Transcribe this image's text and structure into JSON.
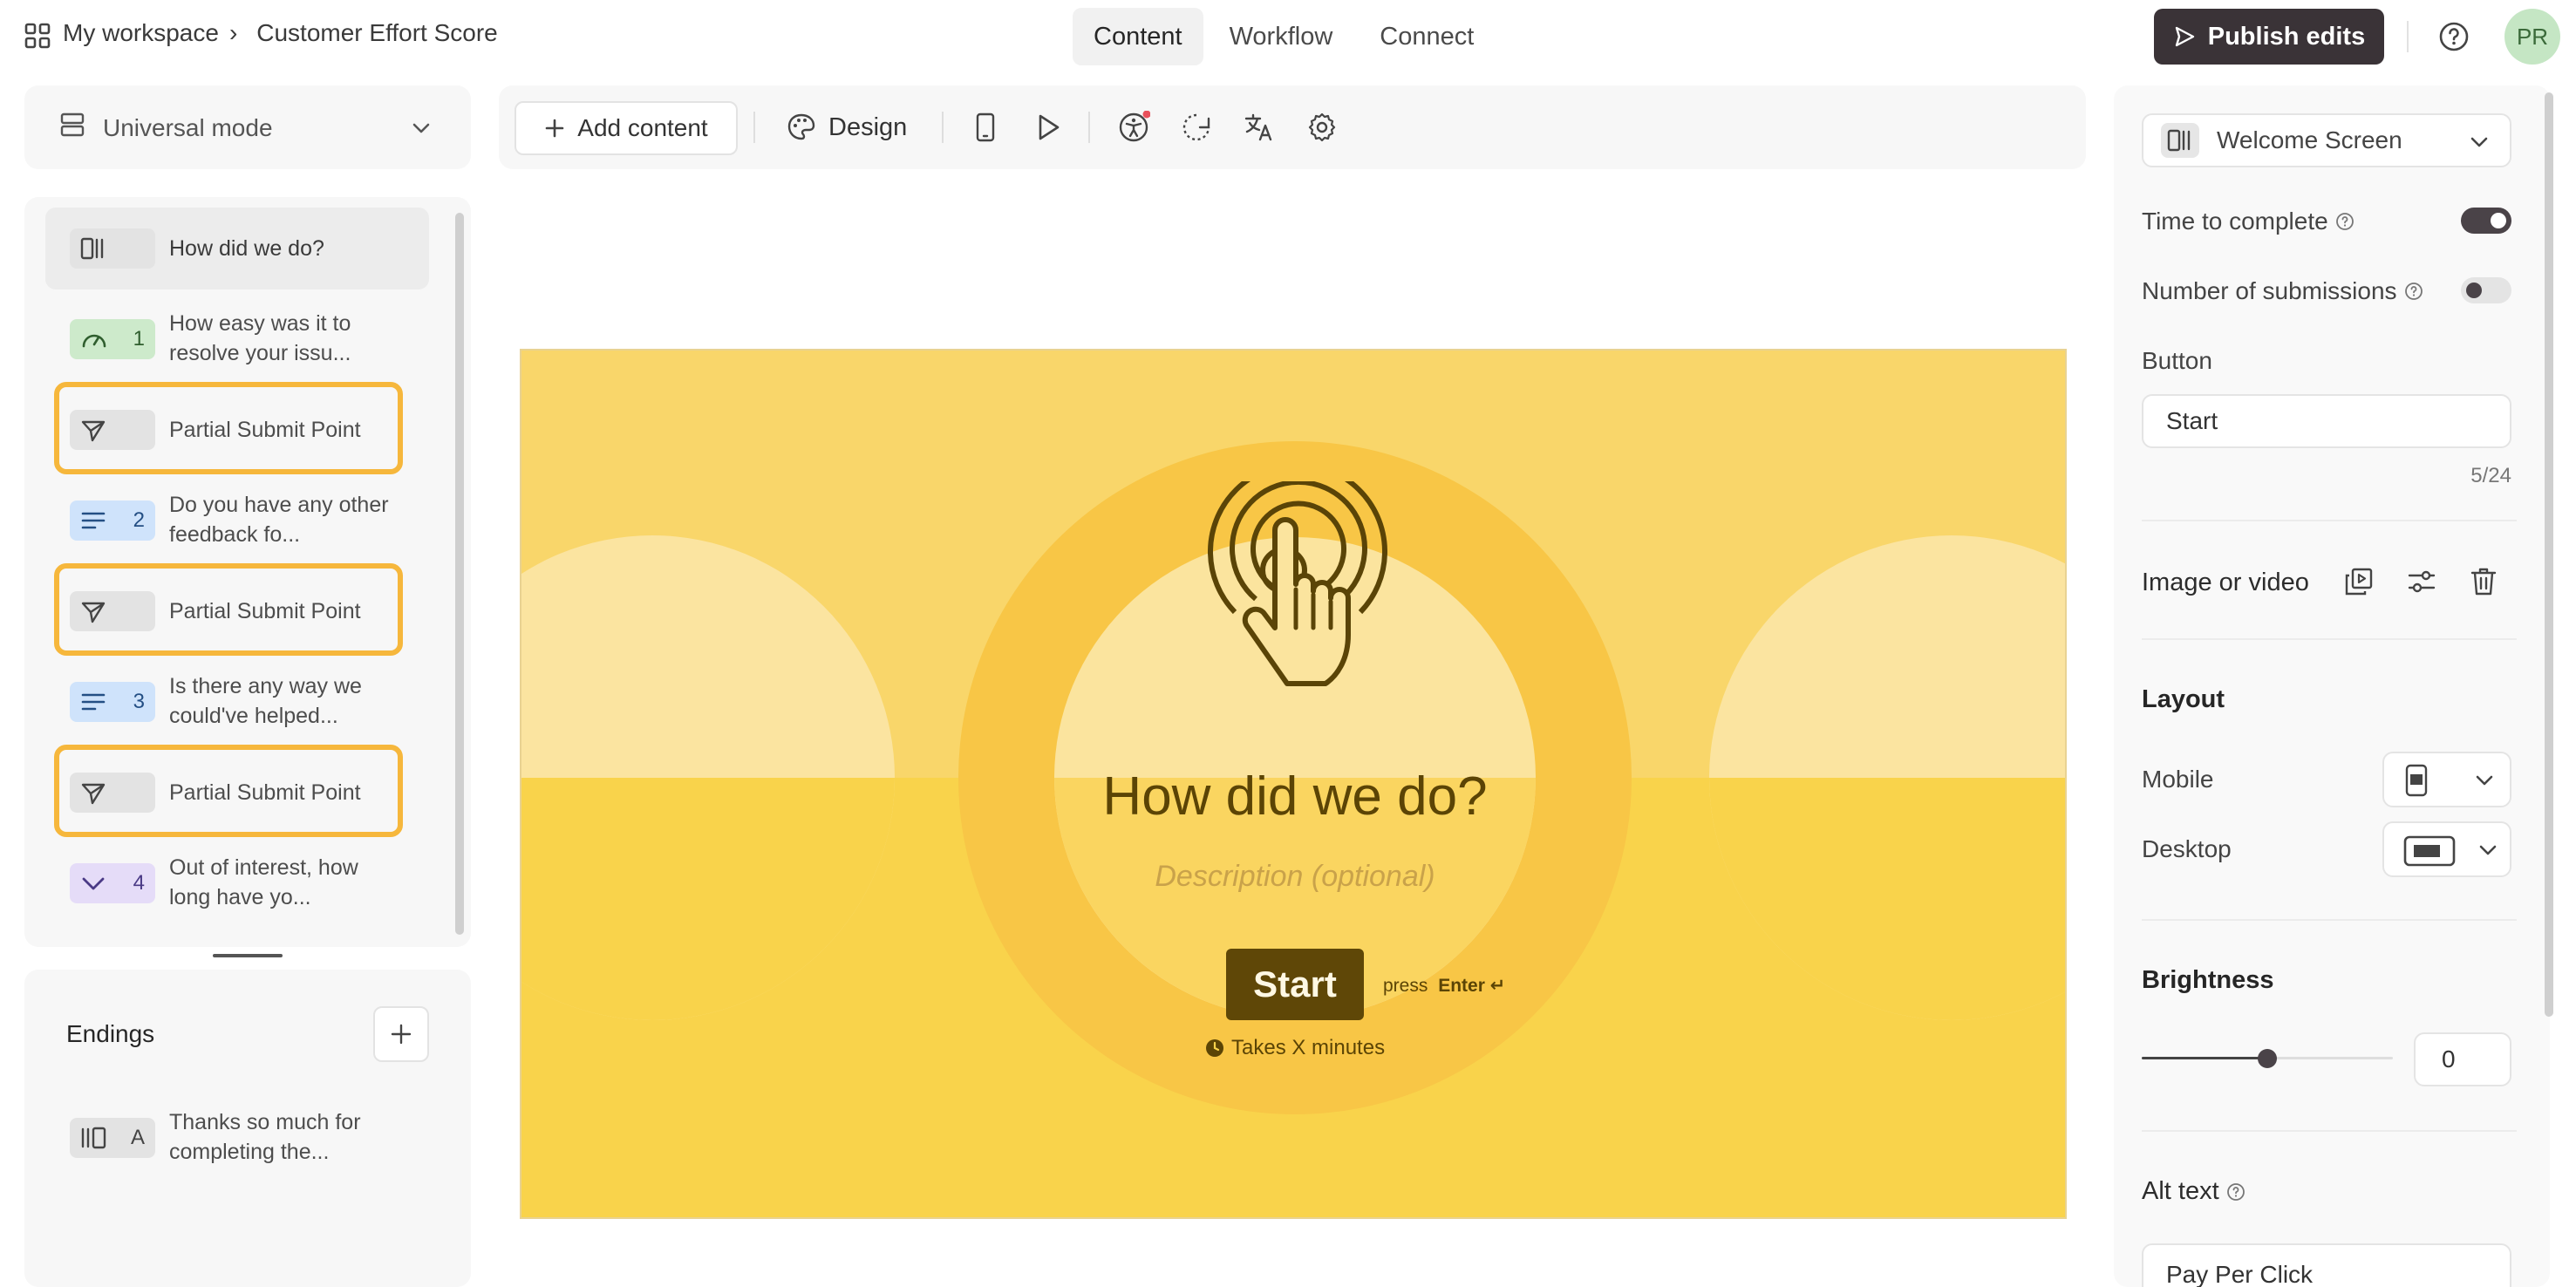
{
  "breadcrumb": {
    "workspace": "My workspace",
    "separator": "›",
    "form_name": "Customer Effort Score"
  },
  "nav_tabs": [
    {
      "label": "Content",
      "active": true
    },
    {
      "label": "Workflow",
      "active": false
    },
    {
      "label": "Connect",
      "active": false
    }
  ],
  "publish_label": "Publish edits",
  "avatar_initials": "PR",
  "mode_select": {
    "label": "Universal mode"
  },
  "toolbar": {
    "add_content": "Add content",
    "design": "Design"
  },
  "questions": [
    {
      "badge": "",
      "text": "How did we do?",
      "type": "welcome",
      "color": "#e3e3e3"
    },
    {
      "badge": "1",
      "text": "How easy was it to resolve your issu...",
      "type": "rating",
      "color": "#cdeacb"
    },
    {
      "badge": "",
      "text": "Partial Submit Point",
      "type": "partial",
      "color": "#e3e3e3"
    },
    {
      "badge": "2",
      "text": "Do you have any other feedback fo...",
      "type": "text",
      "color": "#cfe3fb"
    },
    {
      "badge": "",
      "text": "Partial Submit Point",
      "type": "partial",
      "color": "#e3e3e3"
    },
    {
      "badge": "3",
      "text": "Is there any way we could've helped...",
      "type": "text",
      "color": "#cfe3fb"
    },
    {
      "badge": "",
      "text": "Partial Submit Point",
      "type": "partial",
      "color": "#e3e3e3"
    },
    {
      "badge": "4",
      "text": "Out of interest, how long have yo...",
      "type": "dropdown",
      "color": "#e5dcf8"
    }
  ],
  "endings": {
    "title": "Endings",
    "items": [
      {
        "badge": "A",
        "text": "Thanks so much for completing the..."
      }
    ]
  },
  "preview": {
    "title": "How did we do?",
    "description_placeholder": "Description (optional)",
    "start_label": "Start",
    "press_hint": "press",
    "enter_key": "Enter ↵",
    "time_hint": "Takes X minutes",
    "bg_color": "#f9d66a",
    "button_color": "#5f4707",
    "text_color": "#5b4405"
  },
  "right_panel": {
    "screen_select": "Welcome Screen",
    "time_to_complete": {
      "label": "Time to complete",
      "on": true
    },
    "submissions": {
      "label": "Number of submissions",
      "on": false
    },
    "button": {
      "label": "Button",
      "value": "Start",
      "counter": "5/24"
    },
    "image_video": "Image or video",
    "layout": {
      "title": "Layout",
      "mobile": "Mobile",
      "desktop": "Desktop"
    },
    "brightness": {
      "title": "Brightness",
      "value": "0",
      "level": 0.5
    },
    "alt_text": {
      "label": "Alt text",
      "value": "Pay Per Click"
    }
  }
}
